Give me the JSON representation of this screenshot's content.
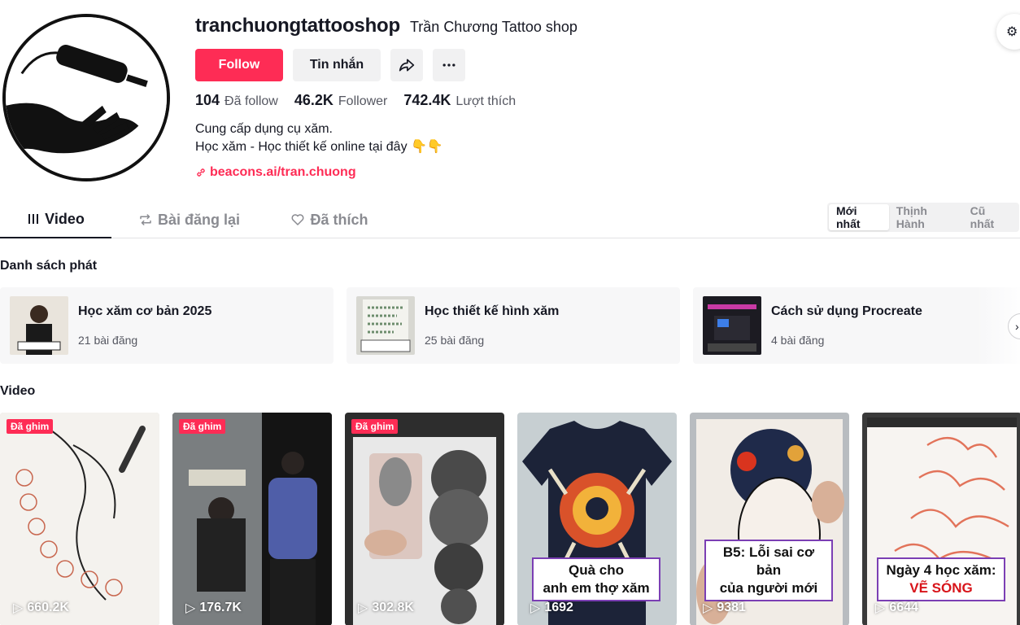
{
  "profile": {
    "username": "tranchuongtattooshop",
    "nickname": "Trần Chương Tattoo shop",
    "follow_label": "Follow",
    "message_label": "Tin nhắn",
    "share_icon": "share-icon",
    "more_icon": "more-icon",
    "stats": [
      {
        "value": "104",
        "label": "Đã follow"
      },
      {
        "value": "46.2K",
        "label": "Follower"
      },
      {
        "value": "742.4K",
        "label": "Lượt thích"
      }
    ],
    "bio_line1": "Cung cấp dụng cụ xăm.",
    "bio_line2": "Học xăm - Học thiết kế online tại đây 👇👇",
    "link": "beacons.ai/tran.chuong"
  },
  "tabs": [
    {
      "label": "Video",
      "icon": "grid-icon",
      "active": true
    },
    {
      "label": "Bài đăng lại",
      "icon": "repost-icon",
      "active": false
    },
    {
      "label": "Đã thích",
      "icon": "heart-icon",
      "active": false
    }
  ],
  "sort": [
    {
      "label": "Mới nhất",
      "active": true
    },
    {
      "label": "Thịnh Hành",
      "active": false
    },
    {
      "label": "Cũ nhất",
      "active": false
    }
  ],
  "playlists_title": "Danh sách phát",
  "playlists": [
    {
      "name": "Học xăm cơ bản 2025",
      "count": "21 bài đăng"
    },
    {
      "name": "Học thiết kế hình xăm",
      "count": "25 bài đăng"
    },
    {
      "name": "Cách sử dụng Procreate",
      "count": "4 bài đăng"
    }
  ],
  "videos_title": "Video",
  "pinned_label": "Đã ghim",
  "videos": [
    {
      "views": "660.2K",
      "pinned": true
    },
    {
      "views": "176.7K",
      "pinned": true
    },
    {
      "views": "302.8K",
      "pinned": true
    },
    {
      "views": "1692",
      "pinned": false,
      "caption_line1": "Quà cho",
      "caption_line2": "anh em thợ xăm"
    },
    {
      "views": "9381",
      "pinned": false,
      "caption_line1": "B5: Lỗi sai cơ bản",
      "caption_line2": "của người mới"
    },
    {
      "views": "6644",
      "pinned": false,
      "caption_line1": "Ngày 4 học xăm:",
      "caption_line2": "VẼ SÓNG"
    }
  ],
  "colors": {
    "accent": "#fe2c55",
    "text": "#161823",
    "muted": "#8a8b91"
  }
}
